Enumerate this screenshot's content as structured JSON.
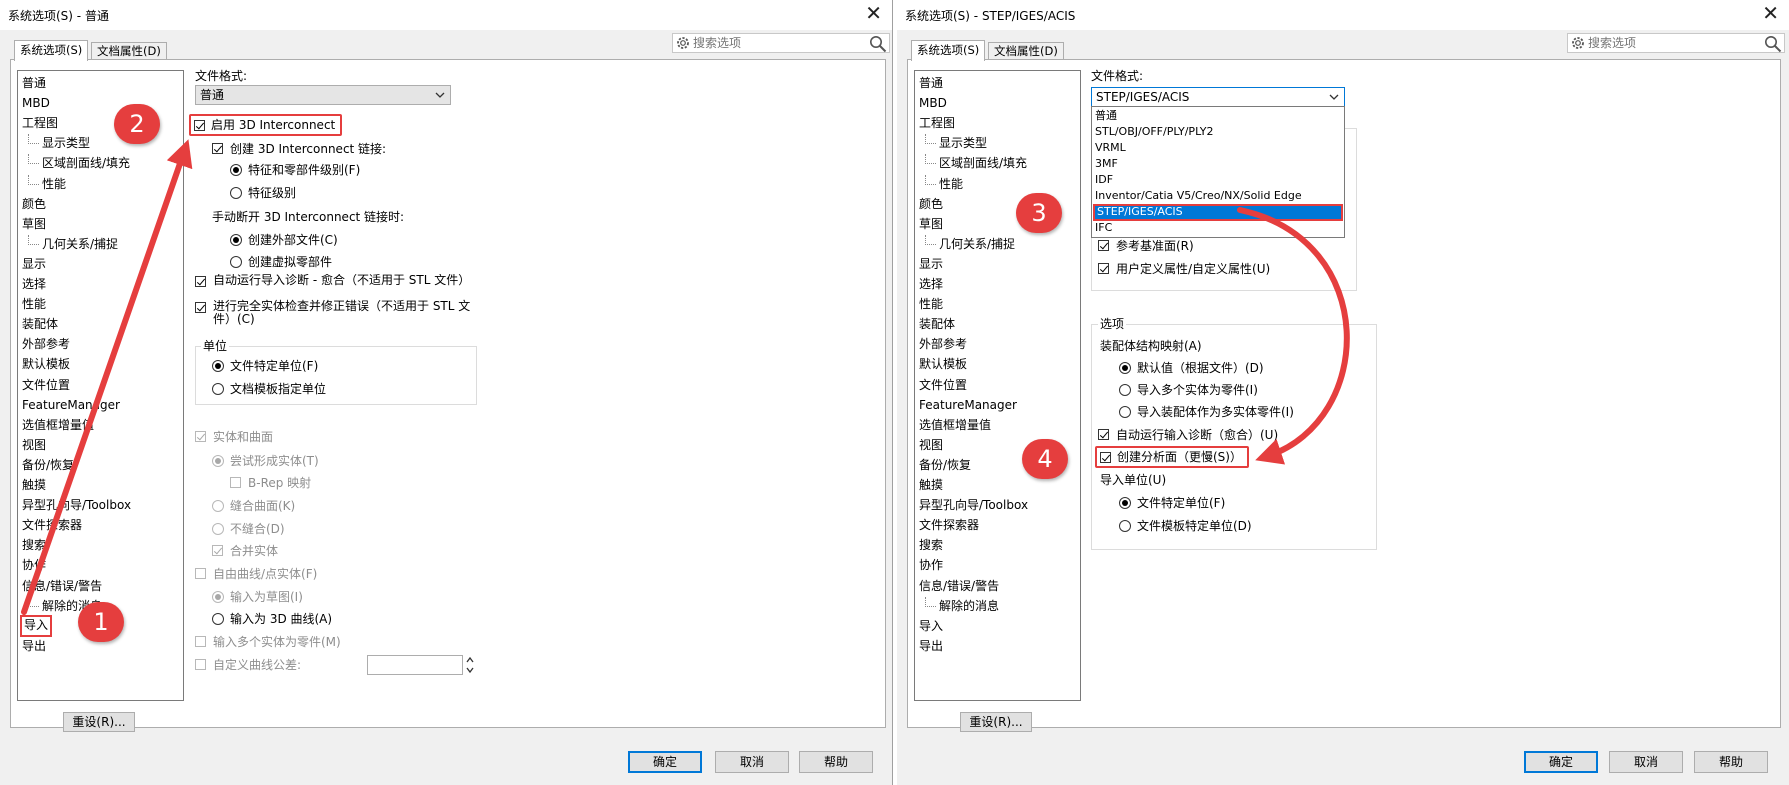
{
  "left": {
    "title": "系统选项(S) - 普通",
    "tabs": [
      "系统选项(S)",
      "文档属性(D)"
    ],
    "search_placeholder": "搜索选项",
    "nav": [
      {
        "label": "普通",
        "child": false
      },
      {
        "label": "MBD",
        "child": false
      },
      {
        "label": "工程图",
        "child": false
      },
      {
        "label": "显示类型",
        "child": true
      },
      {
        "label": "区域剖面线/填充",
        "child": true
      },
      {
        "label": "性能",
        "child": true
      },
      {
        "label": "颜色",
        "child": false
      },
      {
        "label": "草图",
        "child": false
      },
      {
        "label": "几何关系/捕捉",
        "child": true
      },
      {
        "label": "显示",
        "child": false
      },
      {
        "label": "选择",
        "child": false
      },
      {
        "label": "性能",
        "child": false
      },
      {
        "label": "装配体",
        "child": false
      },
      {
        "label": "外部参考",
        "child": false
      },
      {
        "label": "默认模板",
        "child": false
      },
      {
        "label": "文件位置",
        "child": false
      },
      {
        "label": "FeatureManager",
        "child": false
      },
      {
        "label": "选值框增量值",
        "child": false
      },
      {
        "label": "视图",
        "child": false
      },
      {
        "label": "备份/恢复",
        "child": false
      },
      {
        "label": "触摸",
        "child": false
      },
      {
        "label": "异型孔向导/Toolbox",
        "child": false
      },
      {
        "label": "文件探索器",
        "child": false
      },
      {
        "label": "搜索",
        "child": false
      },
      {
        "label": "协作",
        "child": false
      },
      {
        "label": "信息/错误/警告",
        "child": false
      },
      {
        "label": "解除的消息",
        "child": true
      },
      {
        "label": "导入",
        "child": false,
        "selected": true
      },
      {
        "label": "导出",
        "child": false
      }
    ],
    "file_format_label": "文件格式:",
    "file_format_value": "普通",
    "opt_enable": "启用 3D Interconnect",
    "opt_create_link": "创建 3D Interconnect 链接:",
    "opt_feature_part": "特征和零部件级别(F)",
    "opt_feature": "特征级别",
    "break_link_label": "手动断开 3D Interconnect 链接时:",
    "opt_external": "创建外部文件(C)",
    "opt_virtual": "创建虚拟零部件",
    "opt_auto_diag": "自动运行导入诊断 - 愈合（不适用于 STL 文件）",
    "opt_full_check": "进行完全实体检查并修正错误（不适用于 STL 文件）(C)",
    "units_group": "单位",
    "unit_file": "文件特定单位(F)",
    "unit_template": "文档模板指定单位",
    "solid_surface": "实体和曲面",
    "try_solid": "尝试形成实体(T)",
    "brep": "B-Rep 映射",
    "knit": "缝合曲面(K)",
    "no_knit": "不缝合(D)",
    "merge": "合并实体",
    "free_curve": "自由曲线/点实体(F)",
    "as_sketch": "输入为草图(I)",
    "as_3d_curve": "输入为 3D 曲线(A)",
    "multi_body": "输入多个实体为零件(M)",
    "custom_tol": "自定义曲线公差:",
    "reset": "重设(R)...",
    "ok": "确定",
    "cancel": "取消",
    "help": "帮助"
  },
  "right": {
    "title": "系统选项(S) - STEP/IGES/ACIS",
    "tabs": [
      "系统选项(S)",
      "文档属性(D)"
    ],
    "search_placeholder": "搜索选项",
    "nav": [
      {
        "label": "普通",
        "child": false
      },
      {
        "label": "MBD",
        "child": false
      },
      {
        "label": "工程图",
        "child": false
      },
      {
        "label": "显示类型",
        "child": true
      },
      {
        "label": "区域剖面线/填充",
        "child": true
      },
      {
        "label": "性能",
        "child": true
      },
      {
        "label": "颜色",
        "child": false
      },
      {
        "label": "草图",
        "child": false
      },
      {
        "label": "几何关系/捕捉",
        "child": true
      },
      {
        "label": "显示",
        "child": false
      },
      {
        "label": "选择",
        "child": false
      },
      {
        "label": "性能",
        "child": false
      },
      {
        "label": "装配体",
        "child": false
      },
      {
        "label": "外部参考",
        "child": false
      },
      {
        "label": "默认模板",
        "child": false
      },
      {
        "label": "文件位置",
        "child": false
      },
      {
        "label": "FeatureManager",
        "child": false
      },
      {
        "label": "选值框增量值",
        "child": false
      },
      {
        "label": "视图",
        "child": false
      },
      {
        "label": "备份/恢复",
        "child": false
      },
      {
        "label": "触摸",
        "child": false
      },
      {
        "label": "异型孔向导/Toolbox",
        "child": false
      },
      {
        "label": "文件探索器",
        "child": false
      },
      {
        "label": "搜索",
        "child": false
      },
      {
        "label": "协作",
        "child": false
      },
      {
        "label": "信息/错误/警告",
        "child": false
      },
      {
        "label": "解除的消息",
        "child": true
      },
      {
        "label": "导入",
        "child": false
      },
      {
        "label": "导出",
        "child": false
      }
    ],
    "file_format_label": "文件格式:",
    "file_format_value": "STEP/IGES/ACIS",
    "dropdown": [
      "普通",
      "STL/OBJ/OFF/PLY/PLY2",
      "VRML",
      "3MF",
      "IDF",
      "Inventor/Catia V5/Creo/NX/Solid Edge",
      "STEP/IGES/ACIS",
      "IFC"
    ],
    "ref_plane": "参考基准面(R)",
    "user_props": "用户定义属性/自定义属性(U)",
    "options_group": "选项",
    "asm_map": "装配体结构映射(A)",
    "default_by_file": "默认值（根据文件）(D)",
    "multi_as_parts": "导入多个实体为零件(I)",
    "asm_as_multibody": "导入装配体作为多实体零件(I)",
    "auto_diag": "自动运行输入诊断（愈合）(U)",
    "create_analysis": "创建分析面（更慢(S)）",
    "import_units": "导入单位(U)",
    "file_units": "文件特定单位(F)",
    "template_units": "文件模板特定单位(D)",
    "reset": "重设(R)...",
    "ok": "确定",
    "cancel": "取消",
    "help": "帮助"
  },
  "markers": [
    "1",
    "2",
    "3",
    "4"
  ],
  "colors": {
    "accent": "#e53e3e",
    "selection": "#0078d7"
  }
}
